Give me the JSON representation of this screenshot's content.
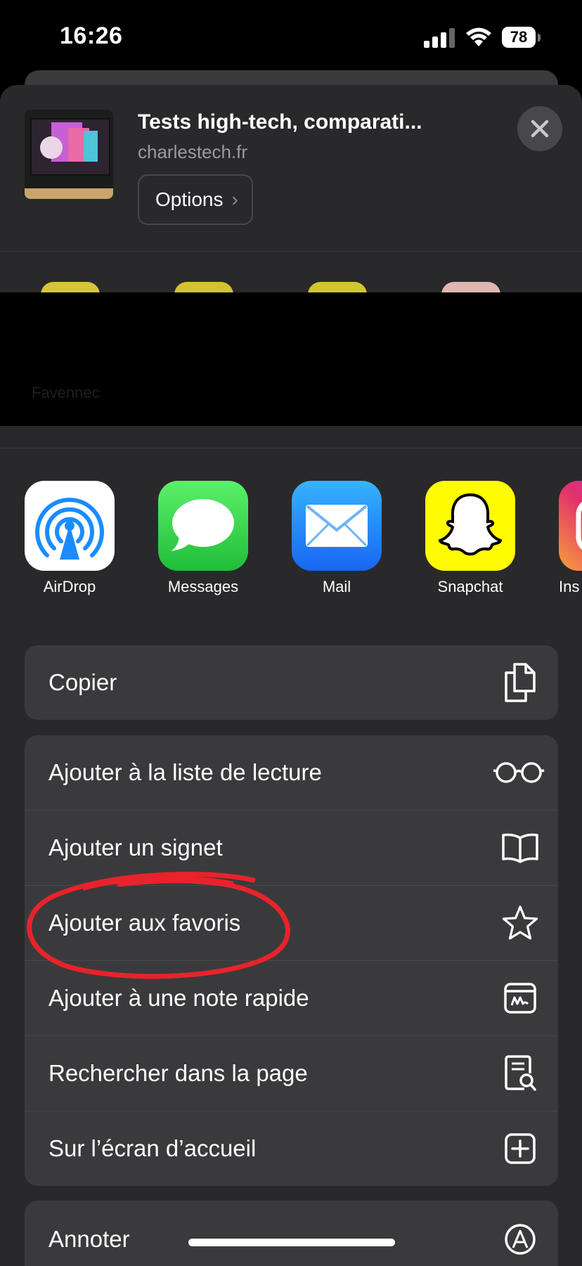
{
  "status": {
    "time": "16:26",
    "battery": "78"
  },
  "share_header": {
    "title": "Tests high-tech, comparati...",
    "domain": "charlestech.fr",
    "options_label": "Options"
  },
  "people": {
    "names": [
      "Favennec"
    ]
  },
  "apps": [
    {
      "label": "AirDrop"
    },
    {
      "label": "Messages"
    },
    {
      "label": "Mail"
    },
    {
      "label": "Snapchat"
    },
    {
      "label": "Ins"
    }
  ],
  "actions": {
    "copy": "Copier",
    "group2": [
      {
        "label": "Ajouter à la liste de lecture",
        "icon": "glasses-icon"
      },
      {
        "label": "Ajouter un signet",
        "icon": "book-icon"
      },
      {
        "label": "Ajouter aux favoris",
        "icon": "star-icon"
      },
      {
        "label": "Ajouter à une note rapide",
        "icon": "quick-note-icon"
      },
      {
        "label": "Rechercher dans la page",
        "icon": "find-in-page-icon"
      },
      {
        "label": "Sur l’écran d’accueil",
        "icon": "add-square-icon"
      }
    ],
    "annotate": "Annoter"
  },
  "colors": {
    "sheet": "#29292b",
    "row": "#3a3a3c",
    "highlight": "#e8232b"
  }
}
